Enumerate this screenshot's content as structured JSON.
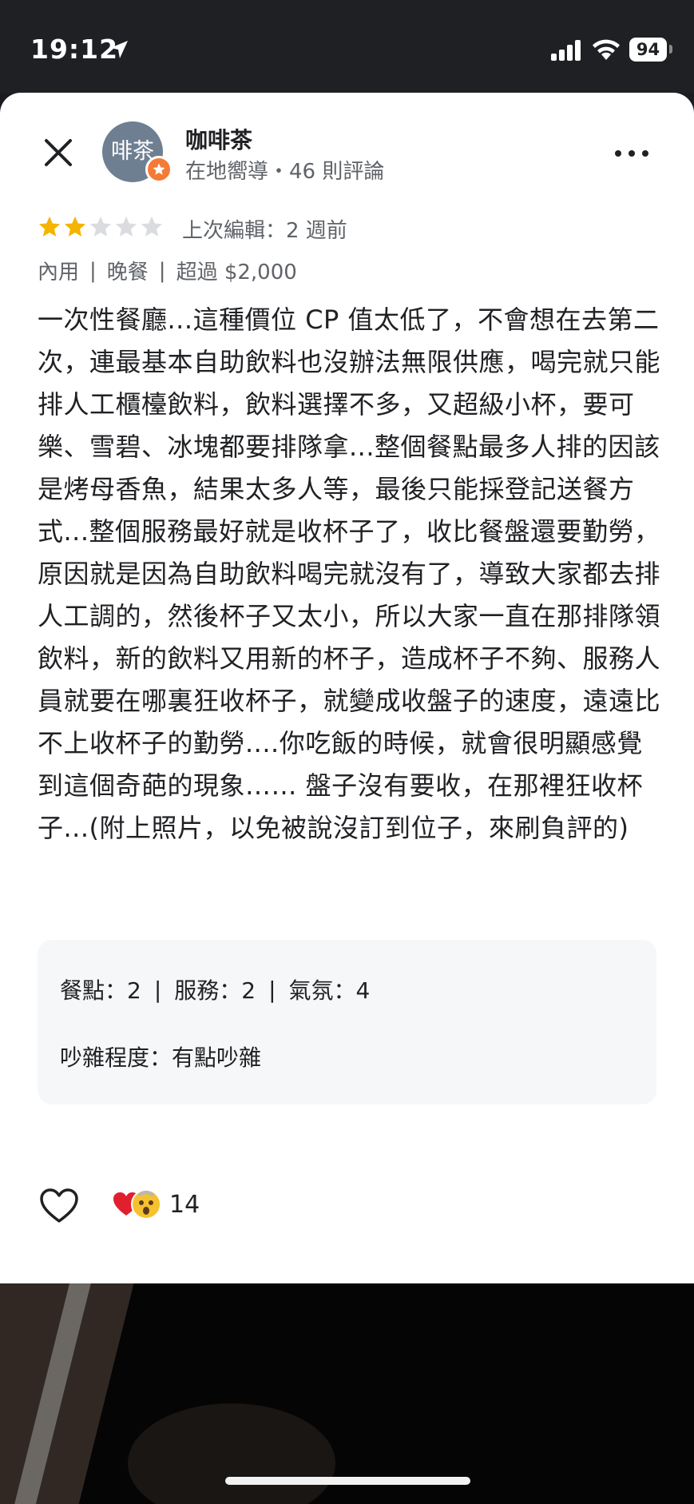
{
  "status_bar": {
    "time": "19:12",
    "battery": "94"
  },
  "header": {
    "avatar_text": "啡茶",
    "name": "咖啡茶",
    "subline": "在地嚮導・46 則評論"
  },
  "rating": {
    "stars": 2,
    "max_stars": 5,
    "edited": "上次編輯：2 週前"
  },
  "tags": [
    "內用",
    "晚餐",
    "超過 $2,000"
  ],
  "review_text": "一次性餐廳...這種價位 CP 值太低了，不會想在去第二次，連最基本自助飲料也沒辦法無限供應，喝完就只能排人工櫃檯飲料，飲料選擇不多，又超級小杯，要可樂、雪碧、冰塊都要排隊拿...整個餐點最多人排的因該是烤母香魚，結果太多人等，最後只能採登記送餐方式...整個服務最好就是收杯子了，收比餐盤還要勤勞，原因就是因為自助飲料喝完就沒有了，導致大家都去排人工調的，然後杯子又太小，所以大家一直在那排隊領飲料，新的飲料又用新的杯子，造成杯子不夠、服務人員就要在哪裏狂收杯子，就變成收盤子的速度，遠遠比不上收杯子的勤勞....你吃飯的時候，就會很明顯感覺到這個奇葩的現象…… 盤子沒有要收，在那裡狂收杯子...(附上照片，以免被說沒訂到位子，來刷負評的)",
  "sub_ratings": {
    "food": "餐點：2",
    "service": "服務：2",
    "atmosphere": "氣氛：4",
    "noise": "吵雜程度：有點吵雜"
  },
  "reactions": {
    "count": "14"
  },
  "colors": {
    "star_filled": "#f4b400",
    "star_empty": "#dadce0",
    "badge": "#f57a35",
    "avatar_bg": "#6f7f92"
  }
}
